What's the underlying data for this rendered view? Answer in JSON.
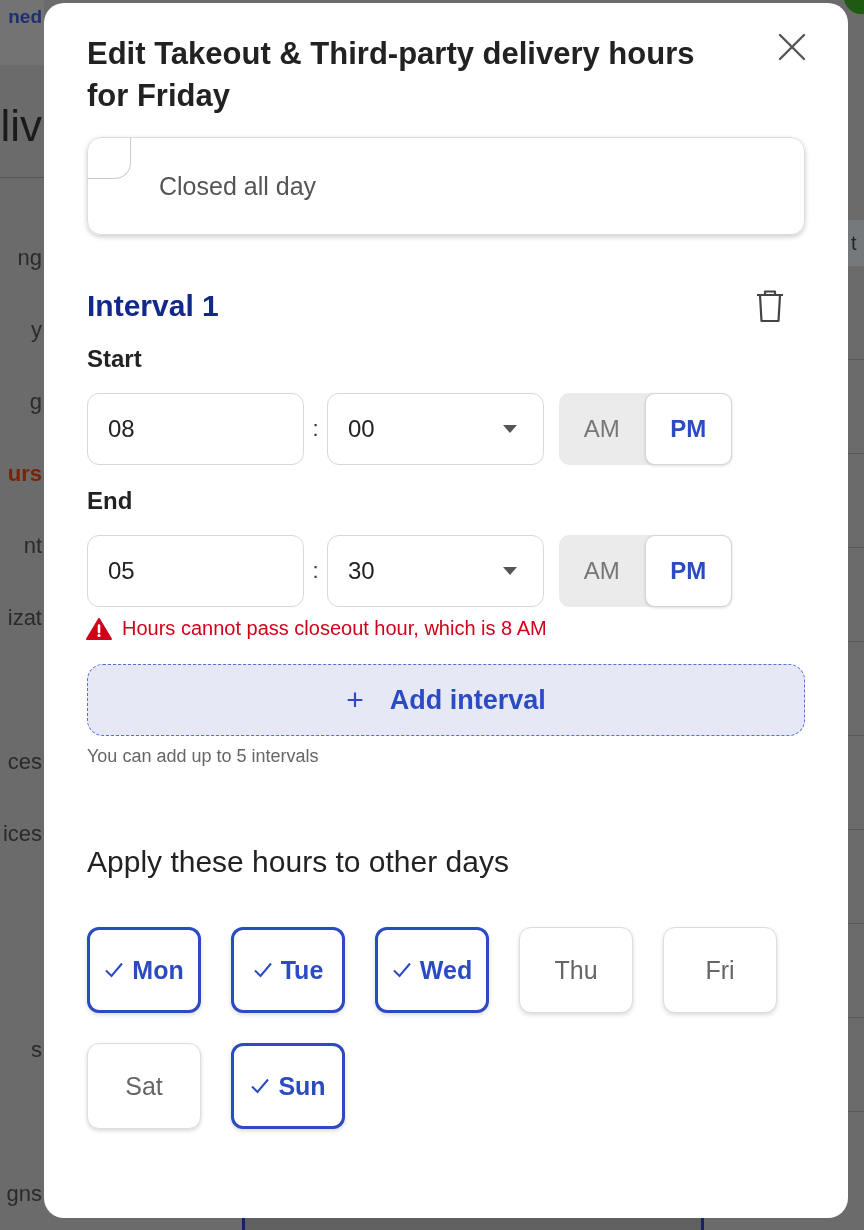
{
  "background_page": {
    "header_link": "ned",
    "page_title": "liv",
    "table_header": "t",
    "nav_items": [
      {
        "label": "ng",
        "selected": false
      },
      {
        "label": "y",
        "selected": false
      },
      {
        "label": "g",
        "selected": false
      },
      {
        "label": "urs",
        "selected": true
      },
      {
        "label": "nt",
        "selected": false
      },
      {
        "label": "izat",
        "selected": false
      },
      {
        "label": "ces",
        "selected": false
      },
      {
        "label": "ices",
        "selected": false
      },
      {
        "label": "s",
        "selected": false
      },
      {
        "label": "gns",
        "selected": false
      }
    ]
  },
  "dialog": {
    "title": "Edit Takeout & Third-party delivery hours for Friday",
    "closed_all_day": {
      "label": "Closed all day",
      "checked": false
    },
    "intervals": [
      {
        "title": "Interval 1",
        "times": [
          {
            "label": "Start",
            "hour": "08",
            "separator": ":",
            "minute": "00",
            "periods": [
              {
                "label": "AM",
                "selected": false
              },
              {
                "label": "PM",
                "selected": true
              }
            ]
          },
          {
            "label": "End",
            "hour": "05",
            "separator": ":",
            "minute": "30",
            "periods": [
              {
                "label": "AM",
                "selected": false
              },
              {
                "label": "PM",
                "selected": true
              }
            ]
          }
        ],
        "error": "Hours cannot pass closeout hour, which is 8 AM"
      }
    ],
    "add_interval": {
      "icon": "+",
      "label": "Add interval",
      "hint": "You can add up to 5 intervals"
    },
    "apply": {
      "title": "Apply these hours to other days",
      "days": [
        {
          "label": "Mon",
          "checked": true
        },
        {
          "label": "Tue",
          "checked": true
        },
        {
          "label": "Wed",
          "checked": true
        },
        {
          "label": "Thu",
          "checked": false
        },
        {
          "label": "Fri",
          "checked": false
        },
        {
          "label": "Sat",
          "checked": false
        },
        {
          "label": "Sun",
          "checked": true
        }
      ]
    }
  }
}
